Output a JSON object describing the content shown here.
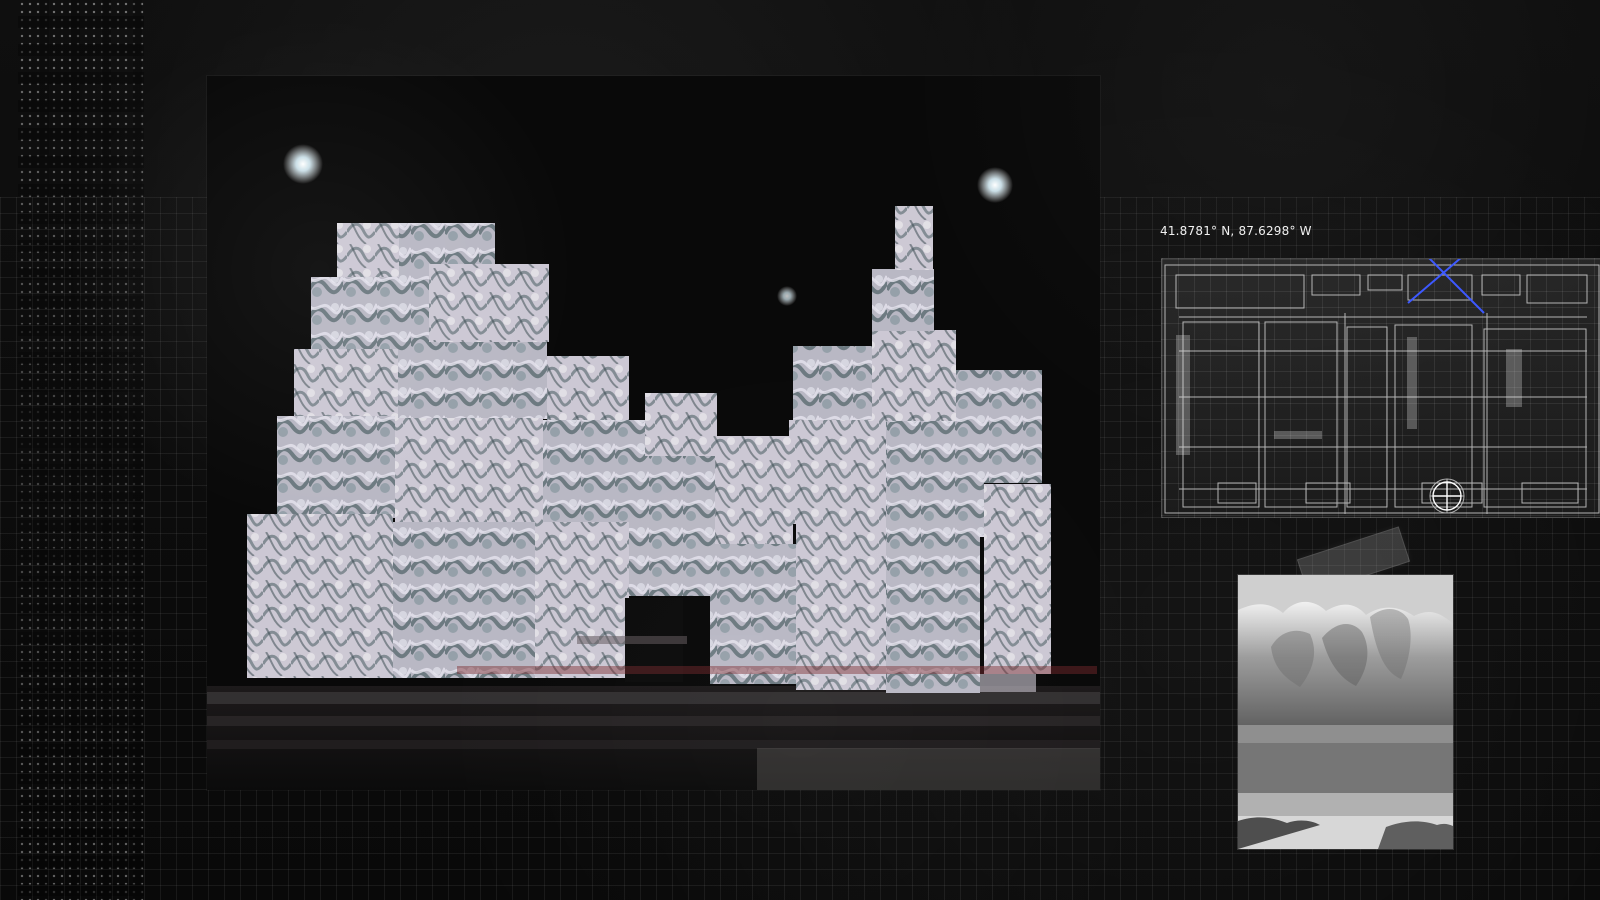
{
  "overlay": {
    "coordinates": "41.8781° N, 87.6298° W"
  },
  "images": {
    "main_photo": "light-projected-cube-sculpture",
    "blueprint": "architectural-floor-plan",
    "statue": "stone-relief-sculpture-photo"
  },
  "icons": {
    "cross_mark": "blue-x-mark-icon",
    "crosshair": "crosshair-icon"
  },
  "colors": {
    "accent_blue": "#3b57ff",
    "grid": "#ffffff",
    "background": "#0b0b0b"
  }
}
